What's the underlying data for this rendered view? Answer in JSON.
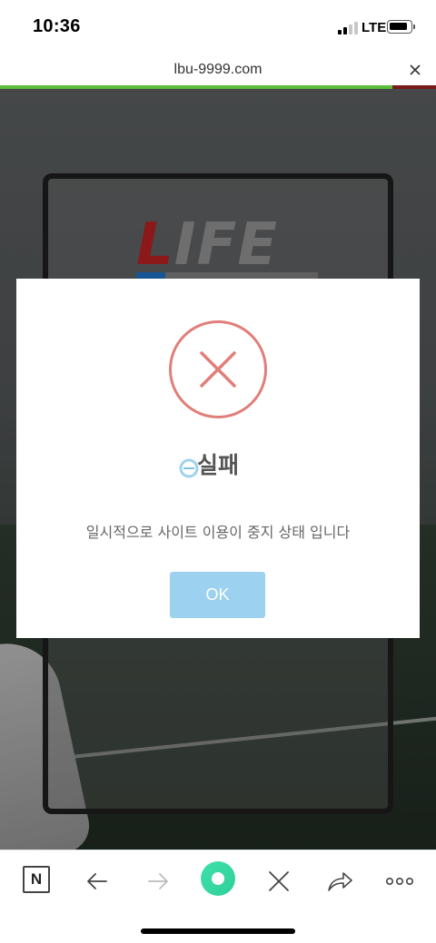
{
  "status_bar": {
    "time": "10:36",
    "network": "LTE",
    "signal_bars_active": 2,
    "signal_bars_total": 4
  },
  "browser": {
    "url": "lbu-9999.com",
    "page_load_progress": 0.9,
    "toolbar": {
      "n_button_label": "N",
      "icons": [
        "n-icon",
        "back-arrow-icon",
        "forward-arrow-icon",
        "home-dot-icon",
        "close-icon",
        "share-icon",
        "more-dots-icon"
      ]
    }
  },
  "page": {
    "logo": {
      "accent_letter": "L",
      "rest": "IFE"
    }
  },
  "dialog": {
    "icon": "error-x-icon",
    "title": "실패",
    "message": "일시적으로 사이트 이용이 중지 상태 입니다",
    "ok_label": "OK"
  },
  "colors": {
    "error_red": "#e07f7a",
    "ok_button": "#9dd1f0",
    "progress_green": "#5bbd3a",
    "home_button": "#3fe0a8",
    "logo_red": "#b32020"
  }
}
